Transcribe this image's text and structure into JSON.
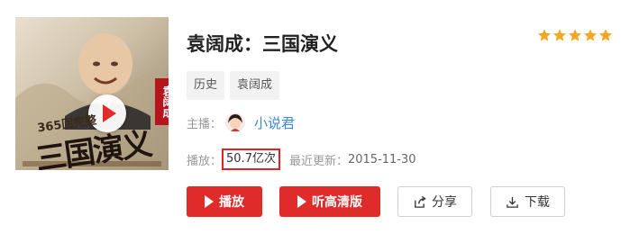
{
  "album": {
    "title": "袁阔成：三国演义",
    "rating_stars": 5,
    "cover": {
      "subtitle": "365回完整",
      "big_title": "三国演义",
      "tag": "袁阔成"
    }
  },
  "tags": [
    "历史",
    "袁阔成"
  ],
  "host": {
    "label": "主播：",
    "name": "小说君"
  },
  "stats": {
    "plays_label": "播放：",
    "plays_value": "50.7亿次",
    "updated_label": "最近更新：",
    "updated_value": "2015-11-30"
  },
  "buttons": {
    "play": "播放",
    "hq": "听高清版",
    "share": "分享",
    "download": "下载"
  },
  "colors": {
    "accent": "#e02b2b",
    "star": "#f5a623",
    "link": "#3e87d6",
    "highlight_box": "#e02424"
  },
  "icons": {
    "cover": "play-circle-icon",
    "rating": "star-icon",
    "play": "play-icon",
    "share": "share-icon",
    "download": "download-icon"
  }
}
